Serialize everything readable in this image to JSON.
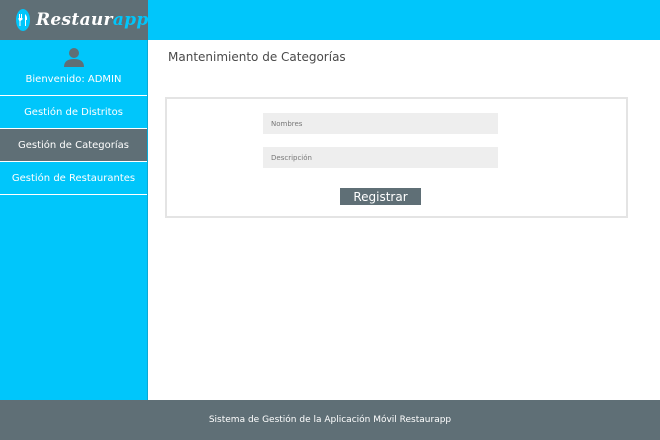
{
  "app": {
    "logo_text_prefix": "Restaur",
    "logo_text_accent": "app",
    "logo_icon": "fork-knife-icon"
  },
  "colors": {
    "accent": "#00c6fb",
    "dark": "#5f6f76",
    "field_bg": "#eeeeee"
  },
  "sidebar": {
    "user_icon": "user-icon",
    "welcome": "Bienvenido: ADMIN",
    "items": [
      {
        "label": "Gestión de Distritos",
        "active": false
      },
      {
        "label": "Gestión de Categorías",
        "active": true
      },
      {
        "label": "Gestión de Restaurantes",
        "active": false
      }
    ]
  },
  "main": {
    "title": "Mantenimiento de Categorías",
    "form": {
      "nombres_placeholder": "Nombres",
      "nombres_value": "",
      "descripcion_placeholder": "Descripción",
      "descripcion_value": "",
      "submit_label": "Registrar"
    }
  },
  "footer": {
    "text": "Sistema de Gestión de la Aplicación Móvil Restaurapp"
  }
}
